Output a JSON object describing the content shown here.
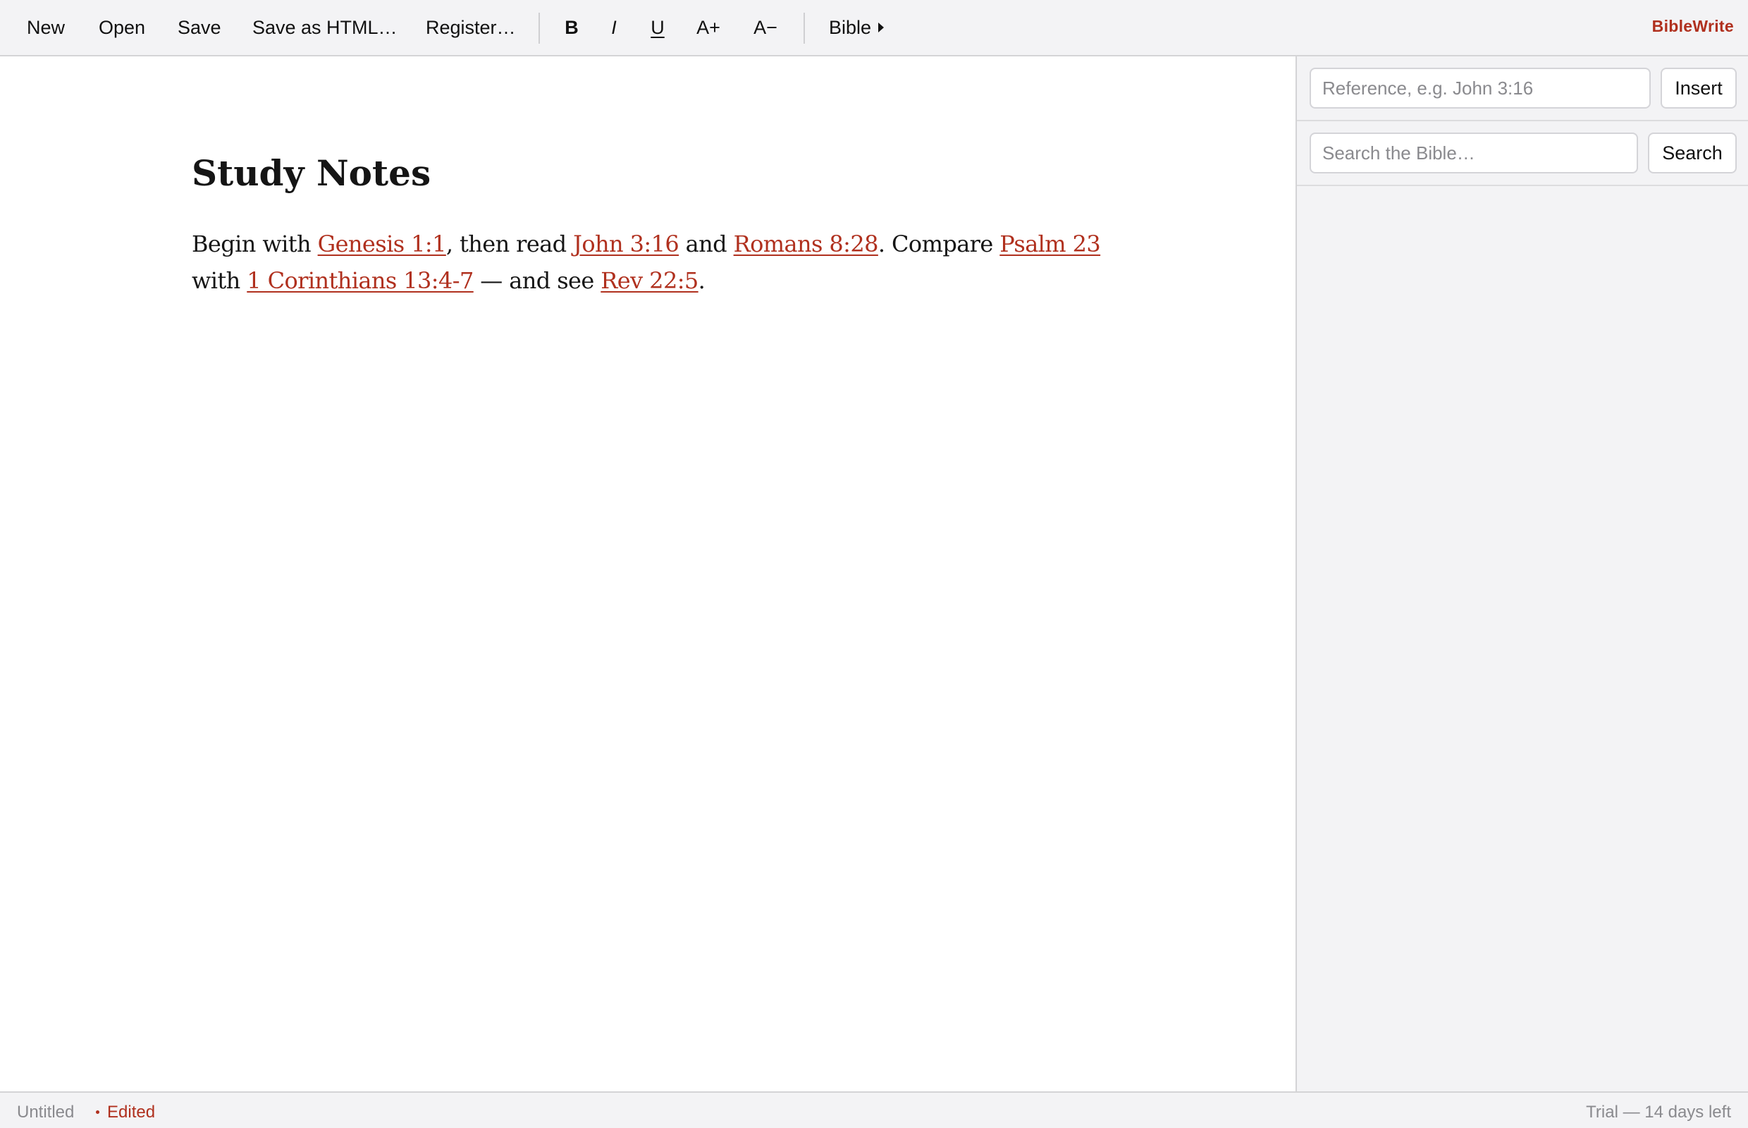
{
  "toolbar": {
    "file_actions": {
      "new": "New",
      "open": "Open",
      "save": "Save",
      "save_as_html": "Save as HTML…",
      "register": "Register…"
    },
    "format_actions": {
      "bold": "B",
      "italic": "I",
      "underline": "U",
      "font_larger": "A+",
      "font_smaller": "A−"
    },
    "bible_menu": "Bible",
    "brand": "BibleWrite"
  },
  "document": {
    "title": "Study Notes",
    "body": {
      "t1": "Begin with ",
      "ref1": "Genesis 1:1",
      "t2": ", then read ",
      "ref2": "John 3:16",
      "t3": " and ",
      "ref3": "Romans 8:28",
      "t4": ". Compare ",
      "ref4": "Psalm 23",
      "t5": " with ",
      "ref5": "1 Corinthians 13:4-7",
      "t6": " — and see ",
      "ref6": "Rev 22:5",
      "t7": "."
    }
  },
  "sidebar": {
    "reference_input": {
      "value": "",
      "placeholder": "Reference, e.g. John 3:16"
    },
    "insert_button": "Insert",
    "search_input": {
      "value": "",
      "placeholder": "Search the Bible…"
    },
    "search_button": "Search"
  },
  "status": {
    "filename": "Untitled",
    "edited": "Edited",
    "trial": "Trial — 14 days left"
  },
  "colors": {
    "accent": "#b0301e",
    "chrome_background": "#f3f3f5",
    "editor_background": "#ffffff",
    "muted_text": "#8a8a8e"
  },
  "icons": {
    "bible_menu": "caret-right-icon",
    "status_edited": "dot-icon"
  }
}
